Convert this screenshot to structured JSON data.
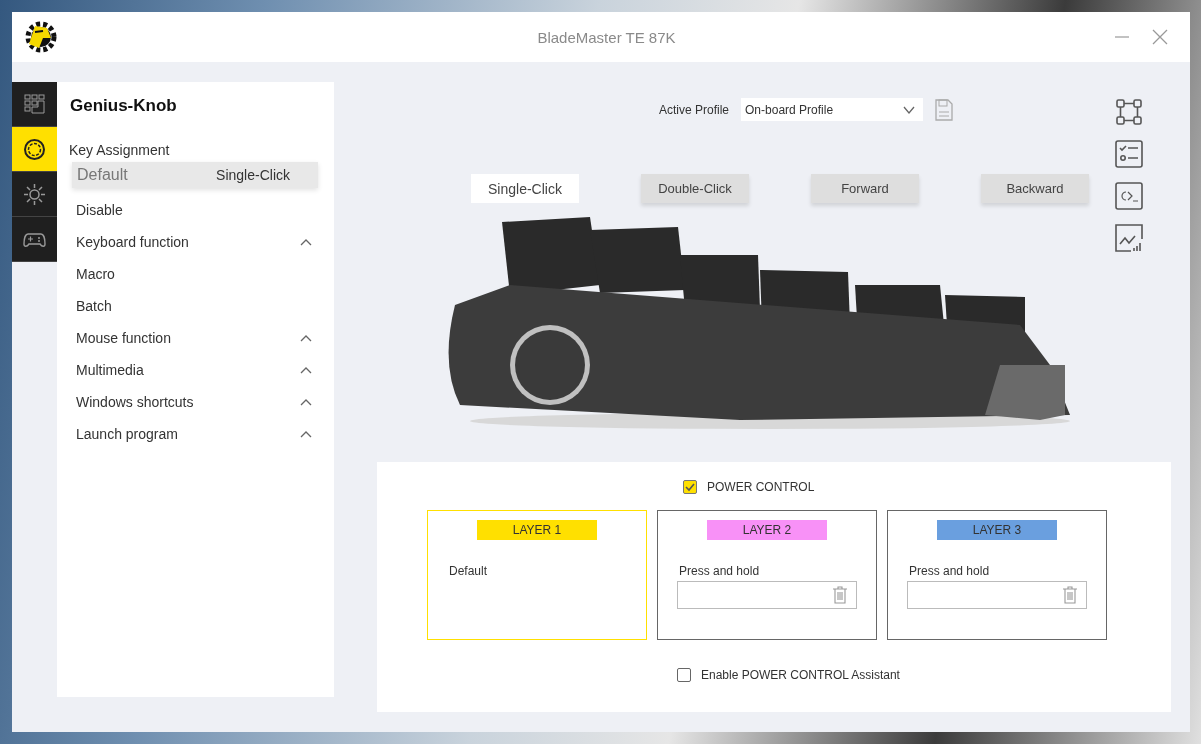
{
  "window": {
    "title": "BladeMaster TE 87K"
  },
  "rail": [
    {
      "selected": false
    },
    {
      "selected": true
    },
    {
      "selected": false
    },
    {
      "selected": false
    }
  ],
  "sidebar": {
    "title": "Genius-Knob",
    "section": "Key Assignment",
    "items": [
      {
        "label": "Default",
        "value": "Single-Click",
        "selected": true,
        "kind": "action"
      },
      {
        "label": "Disable",
        "selected": false,
        "kind": "action"
      },
      {
        "label": "Keyboard function",
        "selected": false,
        "kind": "group"
      },
      {
        "label": "Macro",
        "selected": false,
        "kind": "action"
      },
      {
        "label": "Batch",
        "selected": false,
        "kind": "action"
      },
      {
        "label": "Mouse function",
        "selected": false,
        "kind": "group"
      },
      {
        "label": "Multimedia",
        "selected": false,
        "kind": "group"
      },
      {
        "label": "Windows shortcuts",
        "selected": false,
        "kind": "group"
      },
      {
        "label": "Launch program",
        "selected": false,
        "kind": "group"
      }
    ]
  },
  "profile": {
    "label": "Active Profile",
    "value": "On-board Profile"
  },
  "tabs": [
    {
      "label": "Single-Click",
      "selected": true
    },
    {
      "label": "Double-Click",
      "selected": false
    },
    {
      "label": "Forward",
      "selected": false
    },
    {
      "label": "Backward",
      "selected": false
    }
  ],
  "power_control": {
    "label": "POWER CONTROL",
    "checked": true
  },
  "layers": [
    {
      "title": "LAYER 1",
      "color": "#ffe000",
      "selected": true,
      "kind": "text",
      "text": "Default"
    },
    {
      "title": "LAYER 2",
      "color": "#f891f7",
      "selected": false,
      "kind": "field",
      "label": "Press and hold"
    },
    {
      "title": "LAYER 3",
      "color": "#6a9fdf",
      "selected": false,
      "kind": "field",
      "label": "Press and hold"
    }
  ],
  "assistant": {
    "label": "Enable POWER CONTROL Assistant",
    "checked": false
  }
}
